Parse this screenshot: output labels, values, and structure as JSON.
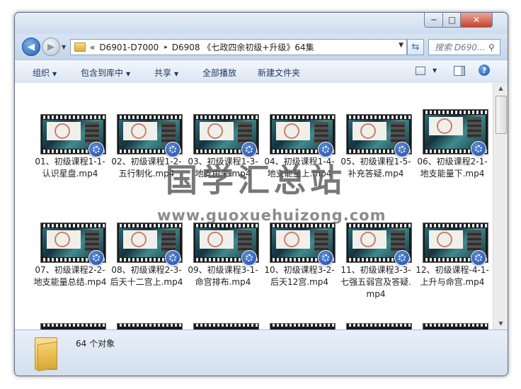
{
  "window": {
    "controls": {
      "minimize": "─",
      "maximize": "□",
      "close": "✕"
    }
  },
  "nav": {
    "breadcrumb_prefix": "«",
    "breadcrumbs": [
      "D6901-D7000",
      "D6908 《七政四余初级+升级》64集"
    ],
    "crumb_separator": "▸",
    "search_placeholder": "搜索 D690..."
  },
  "toolbar": {
    "organize": "组织",
    "include_in_library": "包含到库中",
    "share": "共享",
    "play_all": "全部播放",
    "new_folder": "新建文件夹"
  },
  "files": [
    {
      "name": "01、初级课程1-1-认识星盘.mp4",
      "icon": "video-thumbnail"
    },
    {
      "name": "02、初级课程1-2-五行制化.mp4",
      "icon": "video-thumbnail"
    },
    {
      "name": "03、初级课程1-3-地支由来.mp4",
      "icon": "video-thumbnail"
    },
    {
      "name": "04、初级课程1-4-地支能量上.mp4",
      "icon": "video-thumbnail"
    },
    {
      "name": "05、初级课程1-5-补充答疑.mp4",
      "icon": "video-thumbnail"
    },
    {
      "name": "06、初级课程2-1-地支能量下.mp4",
      "icon": "video-thumbnail"
    },
    {
      "name": "07、初级课程2-2-地支能量总结.mp4",
      "icon": "video-thumbnail"
    },
    {
      "name": "08、初级课程2-3-后天十二宫上.mp4",
      "icon": "video-thumbnail"
    },
    {
      "name": "09、初级课程3-1-命宫排布.mp4",
      "icon": "video-thumbnail"
    },
    {
      "name": "10、初级课程3-2-后天12宫.mp4",
      "icon": "video-thumbnail"
    },
    {
      "name": "11、初级课程3-3-七强五弱宫及答疑.mp4",
      "icon": "video-thumbnail"
    },
    {
      "name": "12、初级课程-4-1-上升与命宫.mp4",
      "icon": "video-thumbnail"
    }
  ],
  "status": {
    "count_text": "64 个对象"
  },
  "watermark": {
    "text": "国学汇总站",
    "url": "www.guoxuehuizong.com"
  },
  "colors": {
    "accent": "#1f5fb5",
    "window_frame": "#c9d9ec",
    "close_button": "#c7432c"
  }
}
